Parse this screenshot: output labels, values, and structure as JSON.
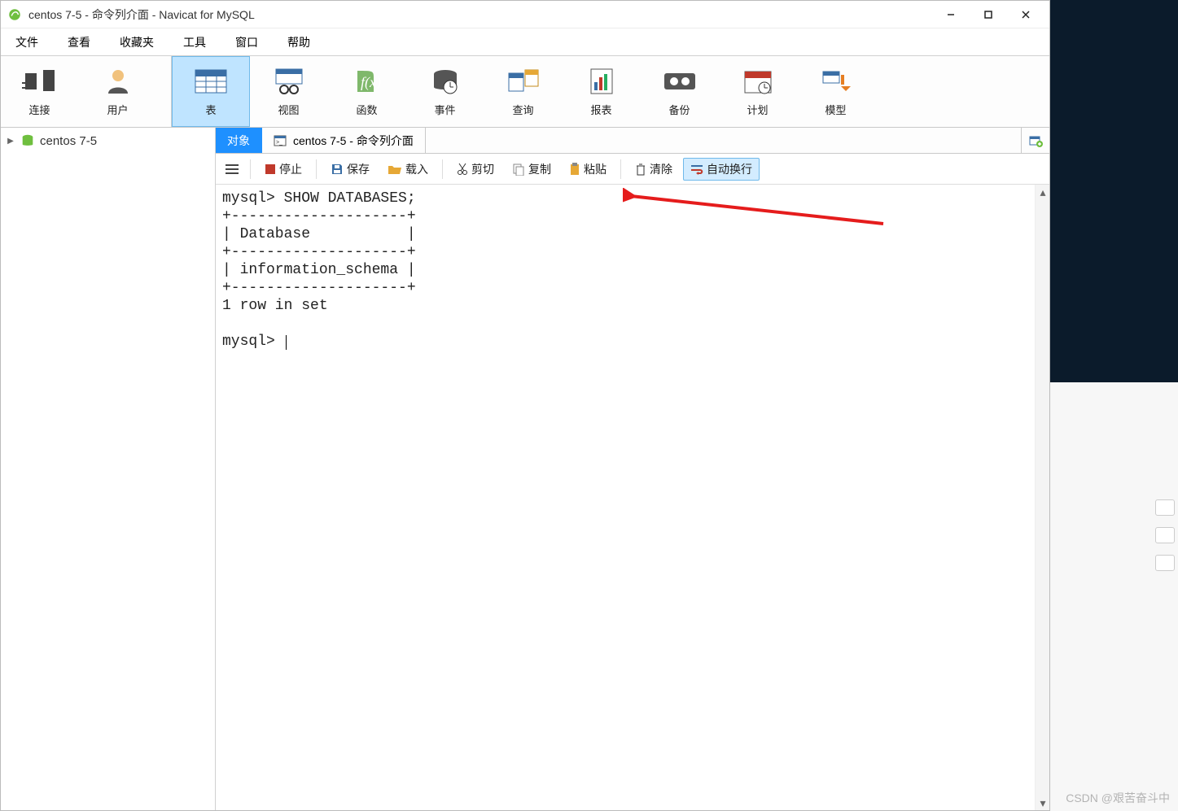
{
  "title": "centos 7-5 - 命令列介面 - Navicat for MySQL",
  "menu": [
    "文件",
    "查看",
    "收藏夹",
    "工具",
    "窗口",
    "帮助"
  ],
  "bigtoolbar": [
    {
      "id": "connect",
      "label": "连接"
    },
    {
      "id": "user",
      "label": "用户"
    },
    {
      "id": "table",
      "label": "表",
      "active": true
    },
    {
      "id": "view",
      "label": "视图"
    },
    {
      "id": "func",
      "label": "函数"
    },
    {
      "id": "event",
      "label": "事件"
    },
    {
      "id": "query",
      "label": "查询"
    },
    {
      "id": "report",
      "label": "报表"
    },
    {
      "id": "backup",
      "label": "备份"
    },
    {
      "id": "schedule",
      "label": "计划"
    },
    {
      "id": "model",
      "label": "模型"
    }
  ],
  "sidebar": {
    "root": "centos 7-5"
  },
  "tabs": [
    {
      "id": "objects",
      "label": "对象",
      "active": true
    },
    {
      "id": "cli",
      "label": "centos 7-5 - 命令列介面"
    }
  ],
  "actionbar": {
    "stop": "停止",
    "save": "保存",
    "load": "载入",
    "cut": "剪切",
    "copy": "复制",
    "paste": "粘贴",
    "clear": "清除",
    "wrap": "自动换行"
  },
  "console": "mysql> SHOW DATABASES;\n+--------------------+\n| Database           |\n+--------------------+\n| information_schema |\n+--------------------+\n1 row in set\n\nmysql> ",
  "watermark": "CSDN @艰苦奋斗中"
}
